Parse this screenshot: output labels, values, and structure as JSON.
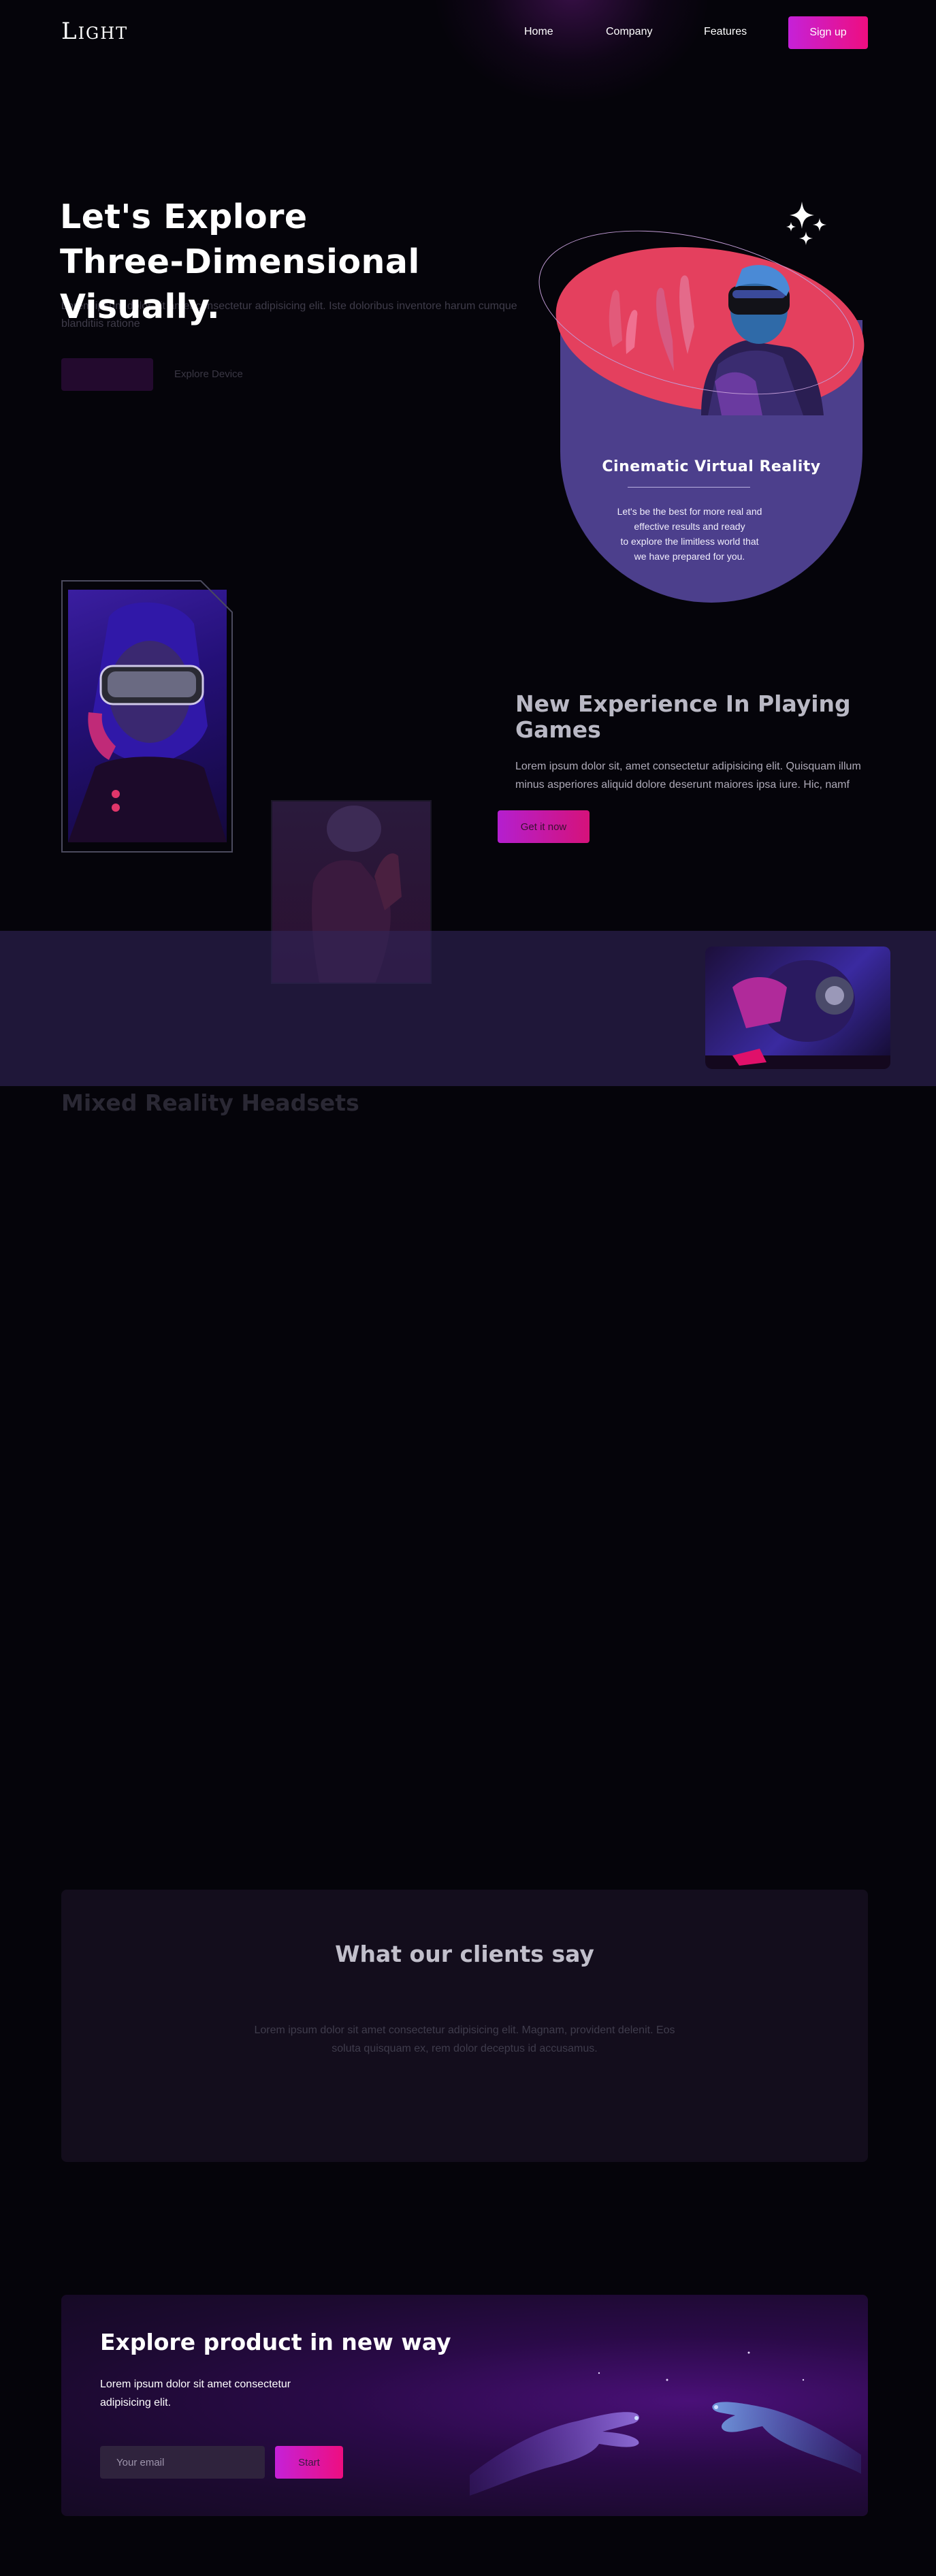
{
  "header": {
    "logo": "Light",
    "nav": [
      {
        "label": "Home"
      },
      {
        "label": "Company"
      },
      {
        "label": "Features"
      }
    ],
    "signup_label": "Sign up"
  },
  "hero": {
    "title_line1": "Let's Explore",
    "title_line2": "Three-Dimensional",
    "title_line3": "Visually.",
    "description": "Lorem ipsum dolor sit amet consectetur adipisicing elit. Iste doloribus inventore harum cumque blanditiis ratione",
    "primary_button": "",
    "secondary_link": "Explore Device"
  },
  "vr_card": {
    "title": "Cinematic Virtual Reality",
    "text_line1": "Let's be the best for more real and",
    "text_line2": "effective results and ready",
    "text_line3": "to explore the limitless world that",
    "text_line4": "we have prepared for you."
  },
  "games": {
    "title_line1": "New Experience In Playing",
    "title_line2": "Games",
    "text_line1": "Lorem ipsum dolor sit, amet consectetur adipisicing elit. Quisquam illum",
    "text_line2": "minus asperiores aliquid dolore deserunt maiores ipsa iure. Hic, namf",
    "button": "Get it now"
  },
  "mixed": {
    "title": "Mixed Reality Headsets"
  },
  "testimonials": {
    "title": "What our clients say",
    "text_line1": "Lorem ipsum dolor sit amet consectetur adipisicing elit. Magnam, provident delenit. Eos",
    "text_line2": "soluta quisquam ex, rem dolor deceptus id accusamus."
  },
  "cta": {
    "title": "Explore product in new way",
    "text_line1": "Lorem ipsum dolor sit amet consectetur",
    "text_line2": "adipisicing elit.",
    "email_placeholder": "Your email",
    "start_label": "Start"
  },
  "colors": {
    "background": "#05040a",
    "accent_start": "#c521d8",
    "accent_end": "#ee0e80",
    "card_purple": "#4c3f8c",
    "card_coral": "#e4405e"
  },
  "icons": [
    "sparkle-icon",
    "vr-person-illustration",
    "cosmic-hands-illustration"
  ]
}
